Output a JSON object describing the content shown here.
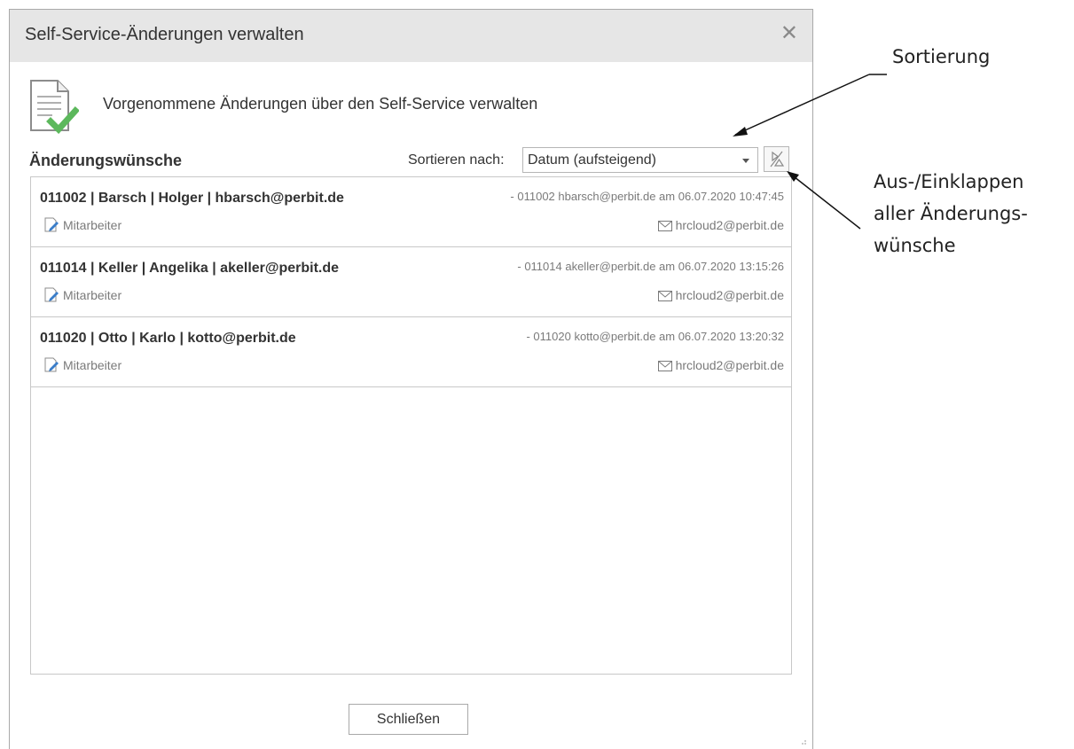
{
  "dialog": {
    "title": "Self-Service-Änderungen verwalten",
    "header_text": "Vorgenommene Änderungen über den Self-Service verwalten",
    "section_title": "Änderungswünsche",
    "sort_label": "Sortieren nach:",
    "sort_value": "Datum (aufsteigend)",
    "close_button": "Schließen",
    "rows": [
      {
        "title": "011002 | Barsch | Holger | hbarsch@perbit.de",
        "meta": "- 011002 hbarsch@perbit.de am 06.07.2020 10:47:45",
        "category": "Mitarbeiter",
        "mail": "hrcloud2@perbit.de"
      },
      {
        "title": "011014 | Keller | Angelika | akeller@perbit.de",
        "meta": "- 011014 akeller@perbit.de am 06.07.2020 13:15:26",
        "category": "Mitarbeiter",
        "mail": "hrcloud2@perbit.de"
      },
      {
        "title": "011020 | Otto | Karlo | kotto@perbit.de",
        "meta": "- 011020 kotto@perbit.de am 06.07.2020 13:20:32",
        "category": "Mitarbeiter",
        "mail": "hrcloud2@perbit.de"
      }
    ]
  },
  "annotations": {
    "sort": "Sortierung",
    "collapse_line1": "Aus-/Einklappen",
    "collapse_line2": "aller Änderungs-",
    "collapse_line3": "wünsche"
  },
  "colors": {
    "titlebar": "#e6e6e6",
    "checkmark": "#5cb85c",
    "border": "#c8c8c8"
  }
}
